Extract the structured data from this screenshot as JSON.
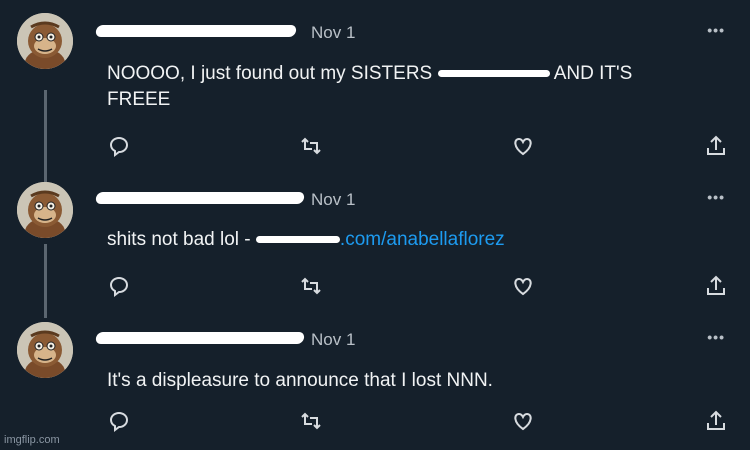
{
  "tweets": [
    {
      "date": "Nov 1",
      "text_before": "NOOOO, I just found out my SISTERS ",
      "text_after": " AND IT'S",
      "text_line2": "FREEE"
    },
    {
      "date": "Nov 1",
      "text_before": "shits not bad lol - ",
      "link_text": ".com/anabellaflorez"
    },
    {
      "date": "Nov 1",
      "text": "It's a displeasure to announce that I lost NNN."
    }
  ],
  "more_label": "•••",
  "watermark": "imgflip.com"
}
